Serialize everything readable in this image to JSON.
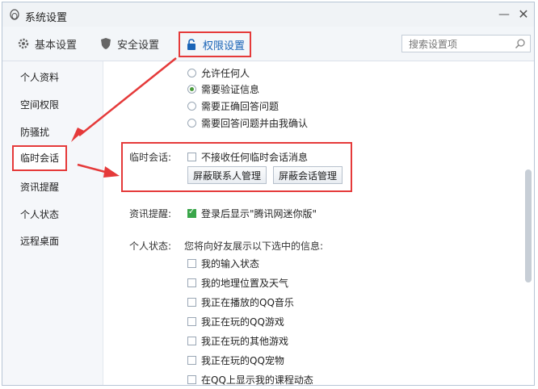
{
  "window": {
    "title": "系统设置",
    "minimize": "—",
    "close": "✕"
  },
  "tabs": [
    {
      "label": "基本设置",
      "icon": "gear-icon"
    },
    {
      "label": "安全设置",
      "icon": "shield-icon"
    },
    {
      "label": "权限设置",
      "icon": "lock-icon"
    }
  ],
  "search": {
    "placeholder": "搜索设置项"
  },
  "sidebar": {
    "items": [
      {
        "label": "个人资料"
      },
      {
        "label": "空间权限"
      },
      {
        "label": "防骚扰"
      },
      {
        "label": "临时会话"
      },
      {
        "label": "资讯提醒"
      },
      {
        "label": "个人状态"
      },
      {
        "label": "远程桌面"
      }
    ]
  },
  "verify_options": [
    {
      "label": "允许任何人",
      "selected": false
    },
    {
      "label": "需要验证信息",
      "selected": true
    },
    {
      "label": "需要正确回答问题",
      "selected": false
    },
    {
      "label": "需要回答问题并由我确认",
      "selected": false
    }
  ],
  "temp_session": {
    "label": "临时会话:",
    "option": "不接收任何临时会话消息",
    "checked": false,
    "btn_contacts": "屏蔽联系人管理",
    "btn_sessions": "屏蔽会话管理"
  },
  "news": {
    "label": "资讯提醒:",
    "option": "登录后显示\"腾讯网迷你版\"",
    "checked": true
  },
  "status": {
    "label": "个人状态:",
    "desc": "您将向好友展示以下选中的信息:",
    "items": [
      {
        "label": "我的输入状态",
        "checked": false
      },
      {
        "label": "我的地理位置及天气",
        "checked": false
      },
      {
        "label": "我正在播放的QQ音乐",
        "checked": false
      },
      {
        "label": "我正在玩的QQ游戏",
        "checked": false
      },
      {
        "label": "我正在玩的其他游戏",
        "checked": false
      },
      {
        "label": "我正在玩的QQ宠物",
        "checked": false
      },
      {
        "label": "在QQ上显示我的课程动态",
        "checked": false
      }
    ]
  },
  "colors": {
    "highlight": "#e53a3a",
    "accent": "#1a64b7",
    "check": "#3aa64a"
  }
}
